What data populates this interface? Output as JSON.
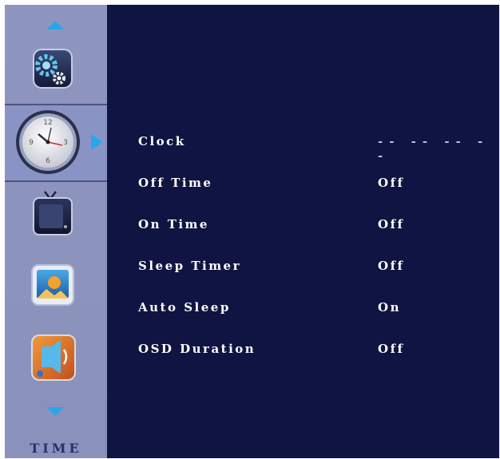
{
  "sidebar": {
    "section_label": "TIME",
    "icons": [
      {
        "name": "settings-gear-icon"
      },
      {
        "name": "clock-icon",
        "selected": true
      },
      {
        "name": "tv-icon"
      },
      {
        "name": "picture-icon"
      },
      {
        "name": "audio-icon"
      }
    ]
  },
  "menu": {
    "items": [
      {
        "label": "Clock",
        "value": "-- -- -- --"
      },
      {
        "label": "Off Time",
        "value": "Off"
      },
      {
        "label": "On Time",
        "value": "Off"
      },
      {
        "label": "Sleep Timer",
        "value": "Off"
      },
      {
        "label": "Auto Sleep",
        "value": "On"
      },
      {
        "label": "OSD Duration",
        "value": "Off"
      }
    ]
  },
  "colors": {
    "background": "#0f1442",
    "sidebar": "#8a92bc",
    "accent": "#27a7ea",
    "text": "#ffffff"
  }
}
